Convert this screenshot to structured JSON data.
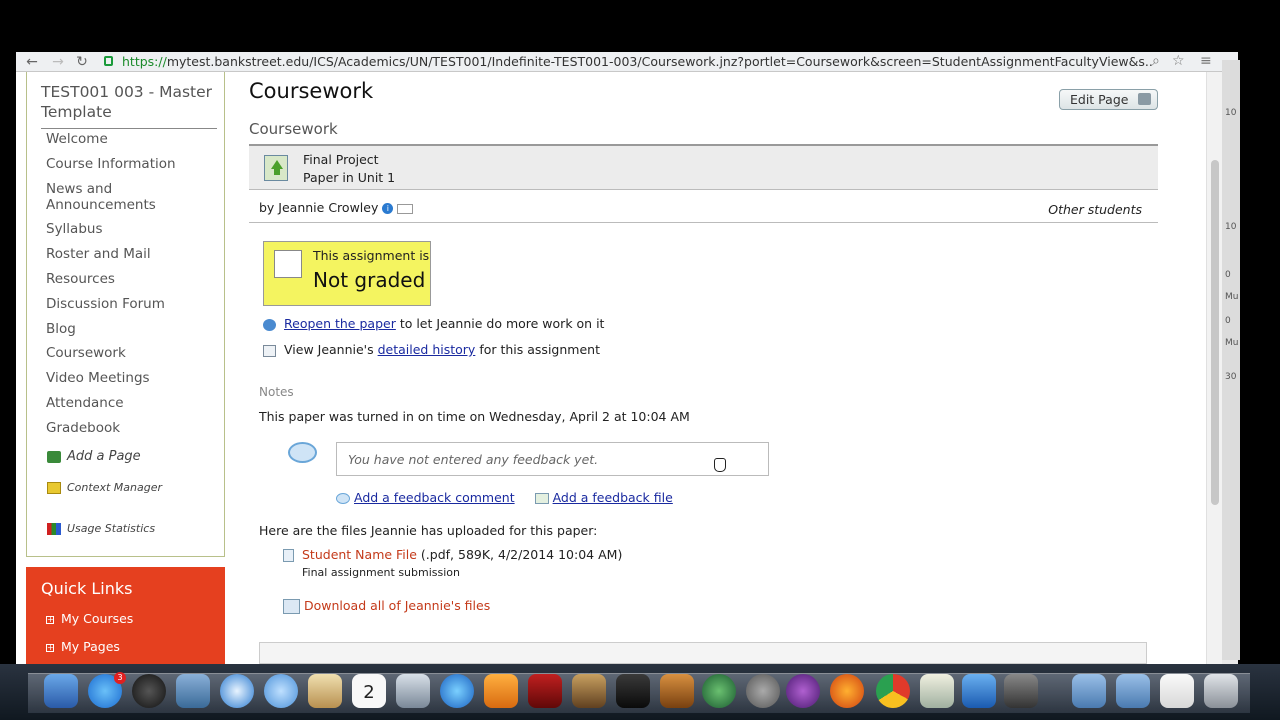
{
  "browser": {
    "url_scheme": "https://",
    "url_rest": "mytest.bankstreet.edu/ICS/Academics/UN/TEST001/Indefinite-TEST001-003/Coursework.jnz?portlet=Coursework&screen=StudentAssignmentFacultyView&s..."
  },
  "sidebar": {
    "site_title": "TEST001 003 - Master Template",
    "items": [
      {
        "label": "Welcome"
      },
      {
        "label": "Course Information"
      },
      {
        "label": "News and Announcements"
      },
      {
        "label": "Syllabus"
      },
      {
        "label": "Roster and Mail"
      },
      {
        "label": "Resources"
      },
      {
        "label": "Discussion Forum"
      },
      {
        "label": "Blog"
      },
      {
        "label": "Coursework"
      },
      {
        "label": "Video Meetings"
      },
      {
        "label": "Attendance"
      },
      {
        "label": "Gradebook"
      }
    ],
    "add_page": "Add a Page",
    "context_manager": "Context Manager",
    "usage_statistics": "Usage Statistics"
  },
  "quick_links": {
    "title": "Quick Links",
    "items": [
      "My Courses",
      "My Pages"
    ]
  },
  "main": {
    "page_title": "Coursework",
    "edit_page": "Edit Page",
    "section_title": "Coursework",
    "assignment_title": "Final Project",
    "assignment_sub": "Paper in Unit 1",
    "by_line": "by Jeannie Crowley",
    "other_students": "Other students",
    "grade_line1": "This assignment is",
    "grade_line2": "Not graded",
    "reopen_link": "Reopen the paper",
    "reopen_rest": " to let Jeannie do more work on it",
    "history_pre": "View Jeannie's ",
    "history_link": "detailed history",
    "history_post": " for this assignment",
    "notes_label": "Notes",
    "turned_in": "This paper was turned in on time on Wednesday, April 2 at 10:04 AM",
    "feedback_placeholder": "You have not entered any feedback yet.",
    "add_comment": "Add a feedback comment",
    "add_file": "Add a feedback file",
    "files_intro": "Here are the files Jeannie has uploaded for this paper:",
    "file_name": "Student Name File",
    "file_meta": " (.pdf, 589K, 4/2/2014 10:04 AM)",
    "file_desc": "Final assignment submission",
    "download_all": "Download all of Jeannie's files"
  },
  "side_peek": [
    "10",
    "10",
    "0",
    "Mu",
    "0",
    "Mu",
    "30"
  ],
  "dock": {
    "app_store_badge": "3",
    "calendar_day": "2"
  }
}
